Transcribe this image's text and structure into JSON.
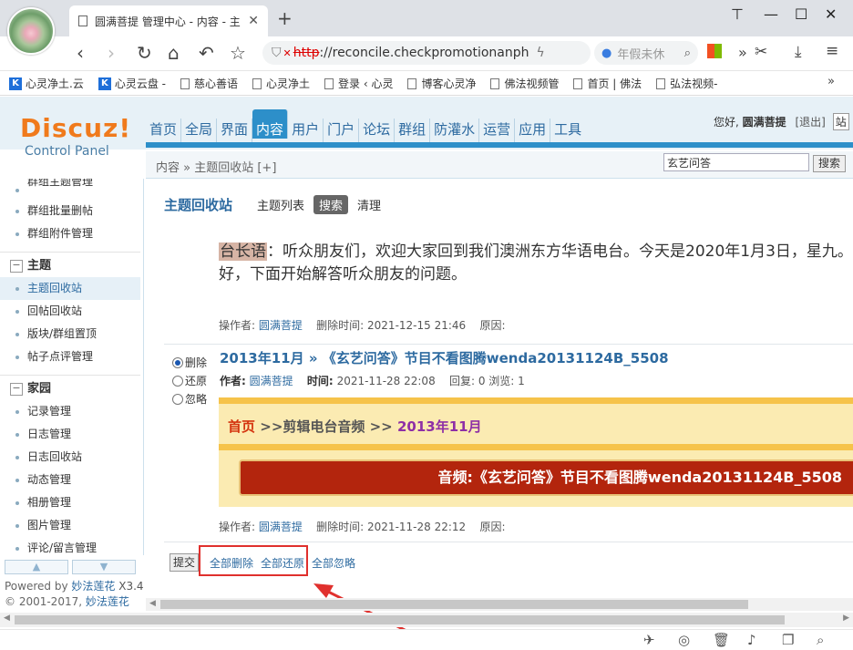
{
  "browser": {
    "tab_title": "圆满菩提 管理中心 - 内容 - 主",
    "url_prefix": "http",
    "url_rest": "://reconcile.checkpromotionanph",
    "search_placeholder": "年假未休",
    "bookmarks": [
      "心灵净土.云",
      "心灵云盘 -",
      "慈心善语",
      "心灵净土",
      "登录 ‹ 心灵",
      "博客心灵净",
      "佛法视频管",
      "首页 | 佛法",
      "弘法视频-"
    ],
    "more": "»"
  },
  "header": {
    "logo": "Discuz!",
    "logo_sub": "Control Panel",
    "nav": [
      "首页",
      "全局",
      "界面",
      "内容",
      "用户",
      "门户",
      "论坛",
      "群组",
      "防灌水",
      "运营",
      "应用",
      "工具"
    ],
    "nav_active_index": 3,
    "greeting": "您好,",
    "username": "圆满菩提",
    "logout": "[退出]",
    "cut": "站"
  },
  "breadcrumb": {
    "text": "内容 » 主题回收站",
    "add": "[+]"
  },
  "search": {
    "value": "玄艺问答",
    "button": "搜索"
  },
  "sidebar": {
    "items_top": [
      "群组主题管理",
      "群组批量删帖",
      "群组附件管理"
    ],
    "section_topic": "主题",
    "items_topic": [
      "主题回收站",
      "回帖回收站",
      "版块/群组置顶",
      "帖子点评管理"
    ],
    "section_home": "家园",
    "items_home": [
      "记录管理",
      "日志管理",
      "日志回收站",
      "动态管理",
      "相册管理",
      "图片管理",
      "评论/留言管理"
    ],
    "powered": "Powered by",
    "powered_brand": "妙法莲花",
    "version": "X3.4",
    "copyright": "© 2001-2017,",
    "copyright_brand": "妙法莲花"
  },
  "main": {
    "title": "主题回收站",
    "subnav": [
      "主题列表",
      "搜索",
      "清理"
    ],
    "quote_hl": "台长语",
    "quote_text": "：听众朋友们，欢迎大家回到我们澳洲东方华语电台。今天是2020年1月3日，星九。好，下面开始解答听众朋友的问题。",
    "meta1": {
      "op_label": "操作者:",
      "op_user": "圆满菩提",
      "del_label": "删除时间:",
      "del_time": "2021-12-15 21:46",
      "reason_label": "原因:"
    },
    "radios": [
      "删除",
      "还原",
      "忽略"
    ],
    "post_title": "2013年11月 » 《玄艺问答》节目不看图腾wenda20131124B_5508",
    "post_info": {
      "author_label": "作者:",
      "author": "圆满菩提",
      "time_label": "时间:",
      "time": "2021-11-28 22:08",
      "stats": "回复: 0 浏览: 1"
    },
    "embed_home": "首页",
    "embed_mid": ">>剪辑电台音频 >>",
    "embed_month": "2013年11月",
    "embed_bar": "音频:《玄艺问答》节目不看图腾wenda20131124B_5508",
    "meta2": {
      "op_label": "操作者:",
      "op_user": "圆满菩提",
      "del_label": "删除时间:",
      "del_time": "2021-11-28 22:12",
      "reason_label": "原因:"
    },
    "submit": "提交",
    "links": [
      "全部删除",
      "全部还原",
      "全部忽略"
    ]
  },
  "colors": {
    "accent": "#2d8fc9",
    "logo": "#f07a1c",
    "highlight_box": "#e0302d",
    "red_bar": "#b3250d"
  }
}
